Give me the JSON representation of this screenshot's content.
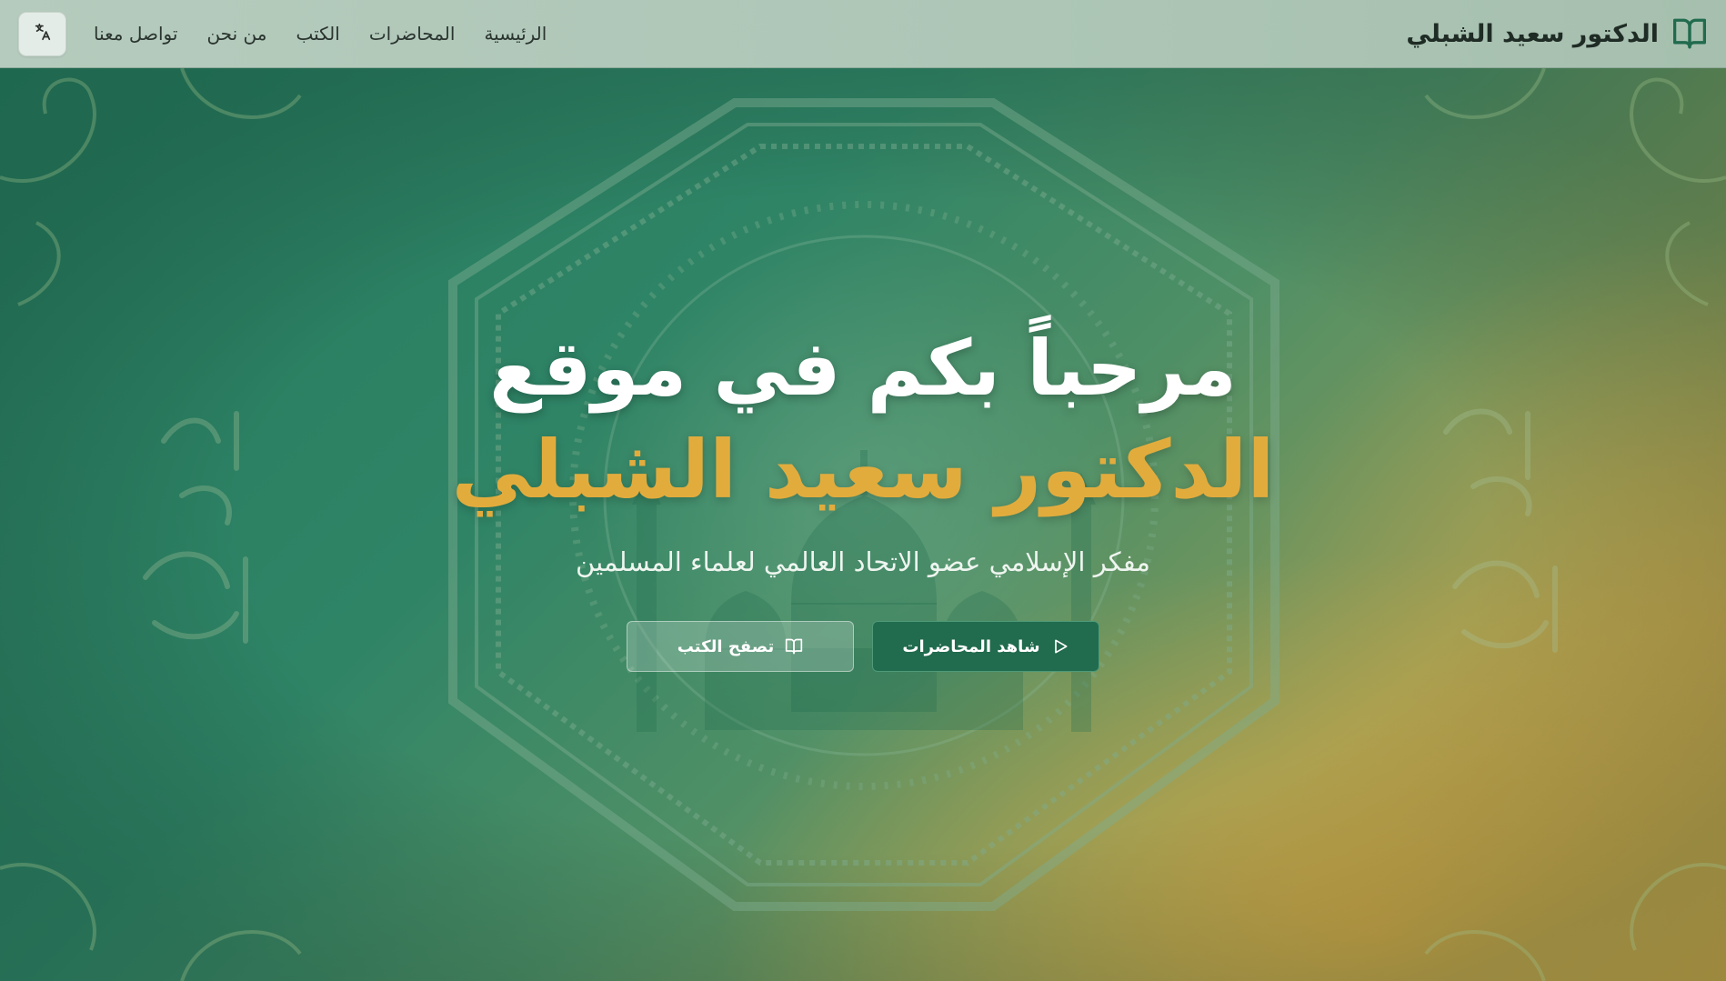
{
  "header": {
    "brand_title": "الدكتور سعيد الشبلي",
    "brand_icon": "book-open-icon",
    "language_icon": "translate-icon",
    "nav": [
      {
        "label": "الرئيسية"
      },
      {
        "label": "المحاضرات"
      },
      {
        "label": "الكتب"
      },
      {
        "label": "من نحن"
      },
      {
        "label": "تواصل معنا"
      }
    ]
  },
  "hero": {
    "welcome": "مرحباً بكم في موقع",
    "name": "الدكتور سعيد الشبلي",
    "subtitle": "مفكر الإسلامي عضو الاتحاد العالمي لعلماء المسلمين",
    "primary_button": {
      "label": "شاهد المحاضرات",
      "icon": "play-icon"
    },
    "secondary_button": {
      "label": "تصفح الكتب",
      "icon": "book-open-icon"
    }
  },
  "colors": {
    "accent_gold": "#e2ac3d",
    "primary_green": "#216b4e",
    "hero_green": "#2f8466"
  }
}
